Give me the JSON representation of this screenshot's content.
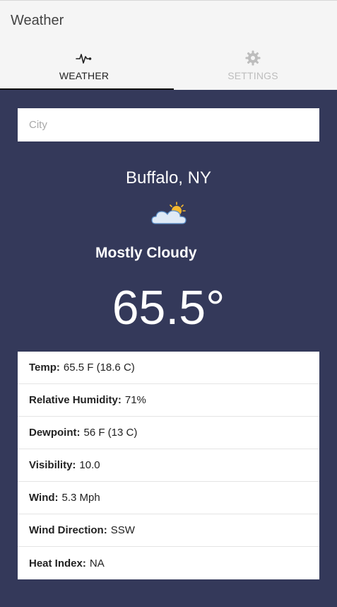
{
  "app": {
    "title": "Weather"
  },
  "tabs": [
    {
      "label": "WEATHER",
      "icon": "pulse-icon",
      "active": true
    },
    {
      "label": "SETTINGS",
      "icon": "gear-icon",
      "active": false
    }
  ],
  "search": {
    "placeholder": "City",
    "value": ""
  },
  "current": {
    "location": "Buffalo, NY",
    "icon": "partly-cloudy-icon",
    "condition": "Mostly Cloudy",
    "temperature": "65.5°"
  },
  "details": [
    {
      "label": "Temp:",
      "value": "65.5 F (18.6 C)"
    },
    {
      "label": "Relative Humidity:",
      "value": "71%"
    },
    {
      "label": "Dewpoint:",
      "value": "56 F (13 C)"
    },
    {
      "label": "Visibility:",
      "value": "10.0"
    },
    {
      "label": "Wind:",
      "value": "5.3 Mph"
    },
    {
      "label": "Wind Direction:",
      "value": "SSW"
    },
    {
      "label": "Heat Index:",
      "value": "NA"
    }
  ],
  "colors": {
    "background": "#34395a",
    "header": "#f5f5f5",
    "active_tab": "#222222",
    "inactive_tab": "#bdbdbd",
    "sun": "#f5b82e"
  }
}
